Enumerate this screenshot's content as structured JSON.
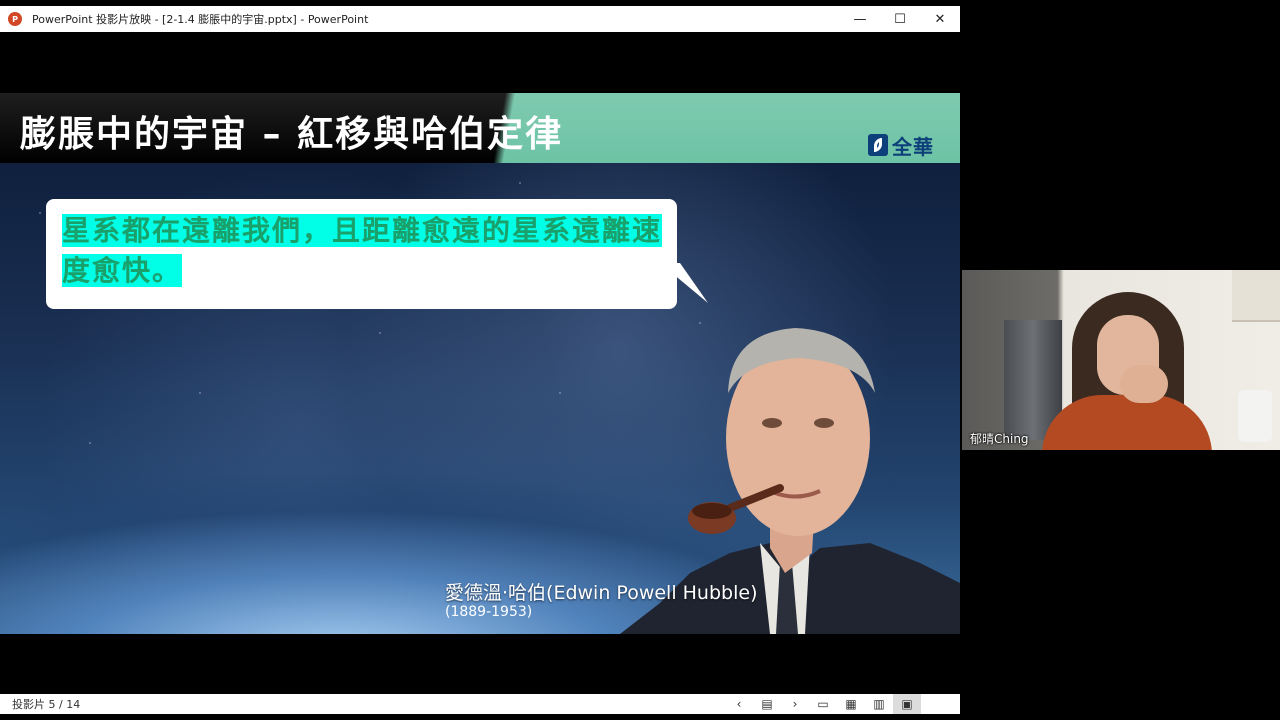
{
  "window": {
    "title": "PowerPoint 投影片放映 - [2-1.4 膨脹中的宇宙.pptx] - PowerPoint",
    "minimize_glyph": "—",
    "maximize_glyph": "☐",
    "close_glyph": "✕"
  },
  "slide": {
    "title": "膨脹中的宇宙 – 紅移與哈伯定律",
    "logo_text": "全華",
    "bubble_text": "星系都在遠離我們，且距離愈遠的星系遠離速度愈快。",
    "caption_name": "愛德溫·哈伯(Edwin Powell Hubble)",
    "caption_years": "(1889-1953)"
  },
  "statusbar": {
    "slide_counter": "投影片 5 / 14",
    "tools": [
      {
        "name": "previous-slide-icon",
        "glyph": "‹"
      },
      {
        "name": "slide-menu-icon",
        "glyph": "▤"
      },
      {
        "name": "next-slide-icon",
        "glyph": "›"
      },
      {
        "name": "normal-view-icon",
        "glyph": "▭"
      },
      {
        "name": "slide-sorter-icon",
        "glyph": "▦"
      },
      {
        "name": "reading-view-icon",
        "glyph": "▥"
      },
      {
        "name": "slideshow-view-icon",
        "glyph": "▣"
      }
    ]
  },
  "webcam": {
    "participant_name": "郁晴Ching"
  },
  "colors": {
    "header_green": "#6dc3a5",
    "highlight_cyan": "#00ffe6",
    "bubble_text_green": "#1aa06a",
    "logo_blue": "#0d3f7a"
  }
}
